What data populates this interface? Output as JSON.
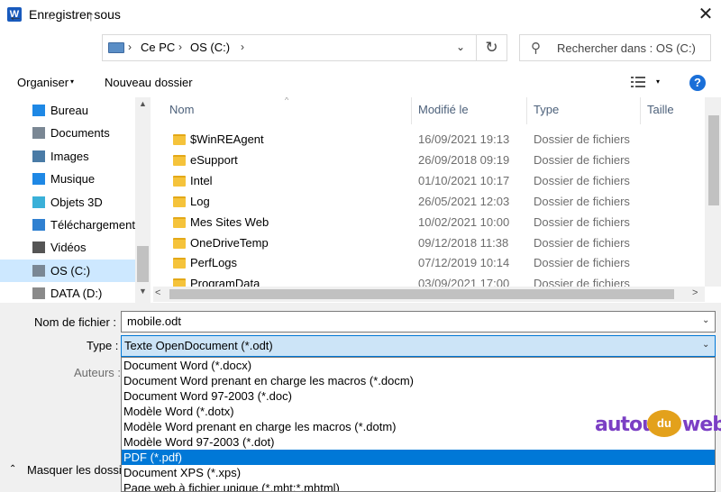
{
  "window": {
    "title": "Enregistrer sous",
    "app_icon": "W",
    "close": "✕"
  },
  "navigation": {
    "back": "←",
    "forward": "→",
    "recent": "⌄",
    "up": "↑",
    "breadcrumb": [
      "Ce PC",
      "OS (C:)"
    ],
    "separator": "›",
    "dropdown": "⌄",
    "refresh": "↻",
    "search_placeholder": "Rechercher dans : OS (C:)"
  },
  "toolbar": {
    "organize_label": "Organiser",
    "organize_arrow": "▾",
    "new_folder_label": "Nouveau dossier",
    "view_arrow": "▾",
    "help_label": "?"
  },
  "sidebar": {
    "items": [
      {
        "label": "Bureau",
        "icon": "desktop-icon",
        "color": "#1e88e5"
      },
      {
        "label": "Documents",
        "icon": "documents-icon",
        "color": "#7a8794"
      },
      {
        "label": "Images",
        "icon": "images-icon",
        "color": "#4a7ba6"
      },
      {
        "label": "Musique",
        "icon": "music-icon",
        "color": "#1e88e5"
      },
      {
        "label": "Objets 3D",
        "icon": "objects-3d-icon",
        "color": "#3ab0d8"
      },
      {
        "label": "Téléchargements",
        "icon": "downloads-icon",
        "color": "#2f80d1"
      },
      {
        "label": "Vidéos",
        "icon": "videos-icon",
        "color": "#555555"
      },
      {
        "label": "OS (C:)",
        "icon": "drive-c-icon",
        "color": "#7a8794",
        "selected": true
      },
      {
        "label": "DATA (D:)",
        "icon": "drive-d-icon",
        "color": "#8a8a8a"
      }
    ],
    "scroll_up": "▲",
    "scroll_down": "▼"
  },
  "filelist": {
    "columns": [
      "Nom",
      "Modifié le",
      "Type",
      "Taille"
    ],
    "sort_indicator": "^",
    "rows": [
      {
        "name": "$WinREAgent",
        "date": "16/09/2021 19:13",
        "type": "Dossier de fichiers"
      },
      {
        "name": "eSupport",
        "date": "26/09/2018 09:19",
        "type": "Dossier de fichiers"
      },
      {
        "name": "Intel",
        "date": "01/10/2021 10:17",
        "type": "Dossier de fichiers"
      },
      {
        "name": "Log",
        "date": "26/05/2021 12:03",
        "type": "Dossier de fichiers"
      },
      {
        "name": "Mes Sites Web",
        "date": "10/02/2021 10:00",
        "type": "Dossier de fichiers"
      },
      {
        "name": "OneDriveTemp",
        "date": "09/12/2018 11:38",
        "type": "Dossier de fichiers"
      },
      {
        "name": "PerfLogs",
        "date": "07/12/2019 10:14",
        "type": "Dossier de fichiers"
      },
      {
        "name": "ProgramData",
        "date": "03/09/2021 17:00",
        "type": "Dossier de fichiers"
      }
    ],
    "scroll_left": "<",
    "scroll_right": ">"
  },
  "form": {
    "filename_label": "Nom de fichier :",
    "filename_value": "mobile.odt",
    "type_label": "Type :",
    "type_value": "Texte OpenDocument (*.odt)",
    "authors_label": "Auteurs :",
    "dropdown_arrow": "⌄",
    "hide_folders_label": "Masquer les dossiers",
    "hide_folders_arrow": "⌃"
  },
  "type_options": [
    {
      "label": "Document Word (*.docx)"
    },
    {
      "label": "Document Word prenant en charge les macros (*.docm)"
    },
    {
      "label": "Document Word 97-2003 (*.doc)"
    },
    {
      "label": "Modèle Word (*.dotx)"
    },
    {
      "label": "Modèle Word prenant en charge les macros (*.dotm)"
    },
    {
      "label": "Modèle Word 97-2003 (*.dot)"
    },
    {
      "label": "PDF (*.pdf)",
      "selected": true
    },
    {
      "label": "Document XPS (*.xps)"
    },
    {
      "label": "Page web à fichier unique (*.mht;*.mhtml)"
    }
  ],
  "watermark": {
    "part1": "autour",
    "part2": "du",
    "part3": "web"
  }
}
